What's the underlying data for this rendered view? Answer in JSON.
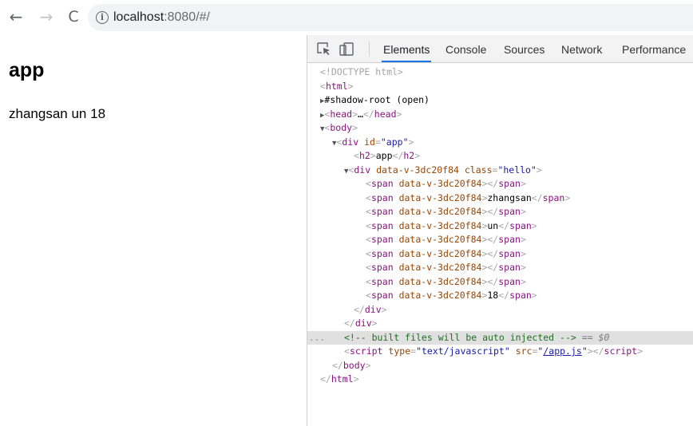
{
  "browser": {
    "back_glyph": "←",
    "forward_glyph": "→",
    "reload_glyph": "C",
    "url_host": "localhost",
    "url_rest": ":8080/#/"
  },
  "page": {
    "heading": "app",
    "text_items": [
      "zhangsan",
      "un",
      "18"
    ]
  },
  "devtools": {
    "tabs": [
      "Elements",
      "Console",
      "Sources",
      "Network",
      "Performance"
    ],
    "active_tab": "Elements",
    "tree": {
      "doctype": "<!DOCTYPE html>",
      "html_open": "html",
      "shadow_root": "#shadow-root (open)",
      "head": "head",
      "head_ellipsis": "…",
      "body": "body",
      "div_tag": "div",
      "id_attr": "id",
      "app_id": "\"app\"",
      "h2_tag": "h2",
      "h2_text": "app",
      "hello_scope_attr": "data-v-3dc20f84",
      "class_attr": "class",
      "class_val": "\"hello\"",
      "span_tag": "span",
      "span_contents": [
        "",
        "zhangsan",
        "",
        "un",
        "",
        "",
        "",
        "",
        "18"
      ],
      "comment": "<!-- built files will be auto injected -->",
      "selected_marker": "== $0",
      "gutter_dots": "...",
      "script_tag": "script",
      "type_attr": "type",
      "type_val": "\"text/javascript\"",
      "src_attr": "src",
      "src_val": "/app.js"
    }
  }
}
